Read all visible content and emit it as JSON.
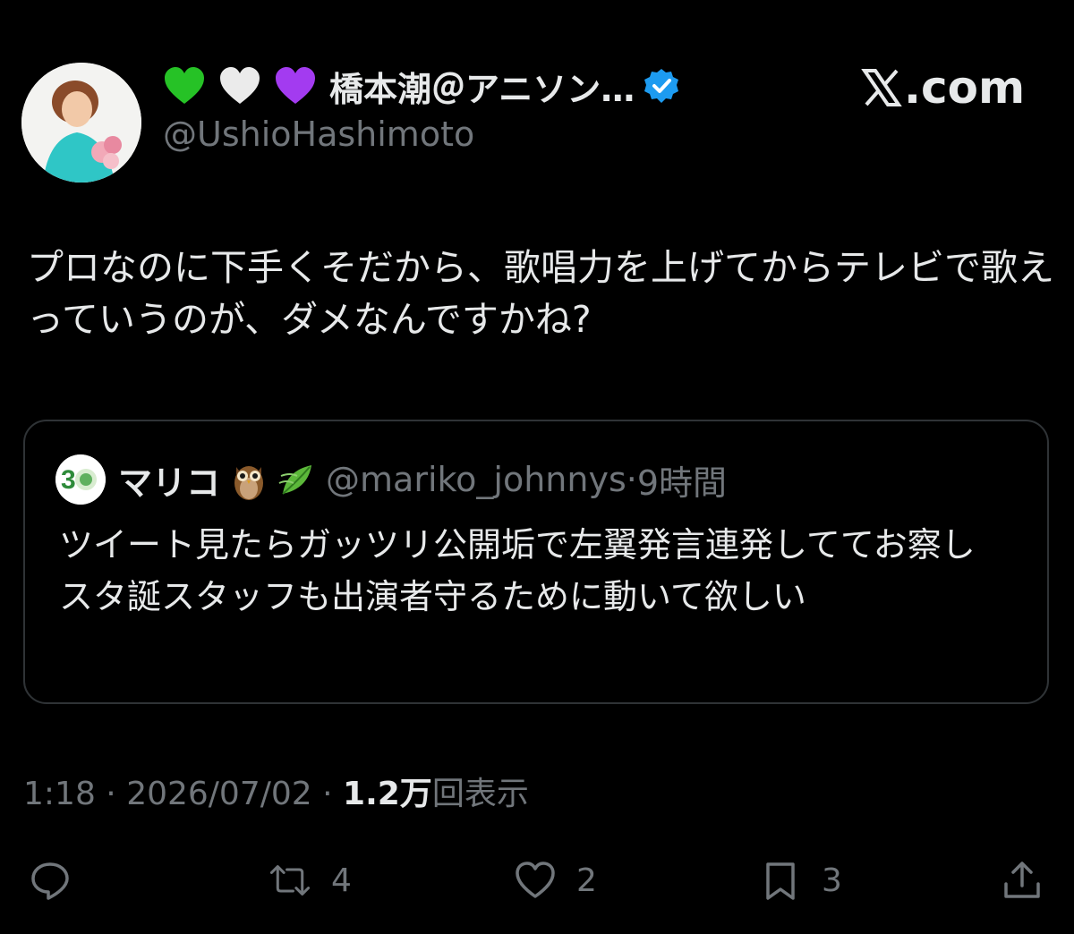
{
  "author": {
    "display_name": "橋本潮＠アニソン…",
    "handle": "@UshioHashimoto",
    "name_emojis": [
      "green-heart",
      "white-heart",
      "purple-heart"
    ],
    "verified": true
  },
  "brand": {
    "domain_text": ".com"
  },
  "tweet": {
    "text": "プロなのに下手くそだから、歌唱力を上げてからテレビで歌えっていうのが、ダメなんですかね?"
  },
  "quoted": {
    "display_name": "マリコ",
    "name_emojis": [
      "owl",
      "leaf-fluttering-in-wind"
    ],
    "handle": "@mariko_johnnys",
    "separator": "·",
    "time": "9時間",
    "text": "ツイート見たらガッツリ公開垢で左翼発言連発しててお察し\nスタ誕スタッフも出演者守るために動いて欲しい"
  },
  "meta": {
    "time": "1:18",
    "sep1": " · ",
    "date": "2026/07/02",
    "sep2": " · ",
    "views_count": "1.2万",
    "views_label": "回表示"
  },
  "actions": {
    "reply_count": "",
    "retweet_count": "4",
    "like_count": "2",
    "bookmark_count": "3"
  },
  "colors": {
    "background": "#000000",
    "text_primary": "#e7e9ea",
    "text_secondary": "#71767b",
    "border": "#2f3336",
    "verified_blue": "#1d9bf0"
  }
}
